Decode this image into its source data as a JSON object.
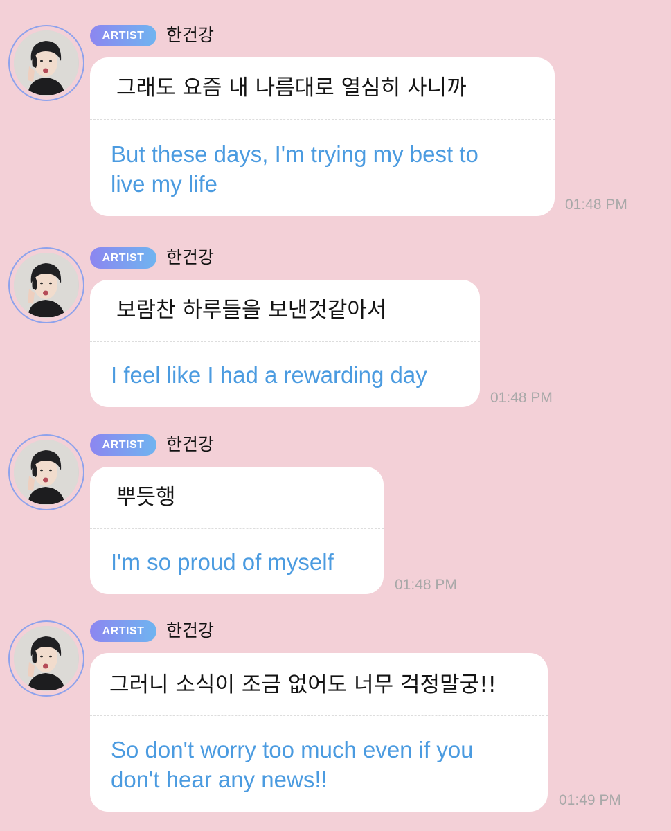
{
  "messages": [
    {
      "badge": "ARTIST",
      "name": "한건강",
      "korean": "그래도 요즘 내 나름대로 열심히 사니까",
      "english_lines": [
        "But these days, I'm trying my best to",
        "live my life"
      ],
      "time": "01:48 PM"
    },
    {
      "badge": "ARTIST",
      "name": "한건강",
      "korean": "보람찬 하루들을 보낸것같아서",
      "english_lines": [
        "I feel like I had a rewarding day"
      ],
      "time": "01:48 PM"
    },
    {
      "badge": "ARTIST",
      "name": "한건강",
      "korean": "뿌듯행",
      "english_lines": [
        "I'm so proud of myself"
      ],
      "time": "01:48 PM"
    },
    {
      "badge": "ARTIST",
      "name": "한건강",
      "korean": "그러니 소식이 조금 없어도 너무 걱정말궁!!",
      "english_lines": [
        "So don't worry too much even if you",
        "don't hear any news!!"
      ],
      "time": "01:49 PM"
    }
  ],
  "colors": {
    "background": "#f3d0d7",
    "bubble": "#ffffff",
    "translation_text": "#4b9be0",
    "badge_gradient_start": "#8c86f0",
    "badge_gradient_end": "#6fb4f0",
    "avatar_ring": "#8da2ec",
    "timestamp": "#a8a8a8"
  },
  "icons": {
    "avatar": "artist-profile-photo"
  }
}
